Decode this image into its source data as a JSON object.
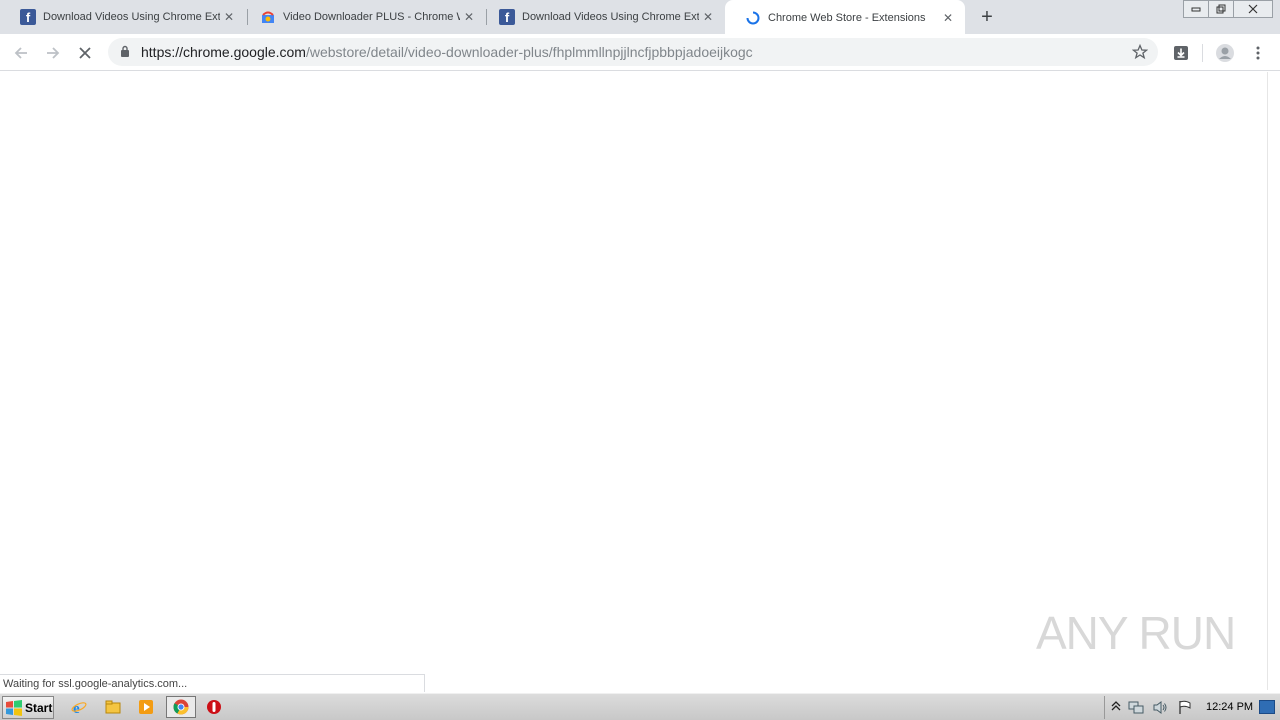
{
  "tabs": [
    {
      "title": "Download Videos Using Chrome Exte",
      "favicon": "facebook-icon"
    },
    {
      "title": "Video Downloader PLUS - Chrome We",
      "favicon": "webstore-icon"
    },
    {
      "title": "Download Videos Using Chrome Exte",
      "favicon": "facebook-icon"
    },
    {
      "title": "Chrome Web Store - Extensions",
      "favicon": "loading-spinner-icon",
      "active": true
    }
  ],
  "new_tab_label": "+",
  "toolbar": {
    "url_host": "https://chrome.google.com",
    "url_path": "/webstore/detail/video-downloader-plus/fhplmmllnpjjlncfjpbbpjadoeijkogc"
  },
  "status_text": "Waiting for ssl.google-analytics.com...",
  "watermark": "ANY RUN",
  "taskbar": {
    "start_label": "Start",
    "clock": "12:24 PM"
  },
  "colors": {
    "tabstrip_bg": "#dee1e6",
    "facebook_blue": "#3b5998",
    "spinner_blue": "#1a73e8"
  }
}
